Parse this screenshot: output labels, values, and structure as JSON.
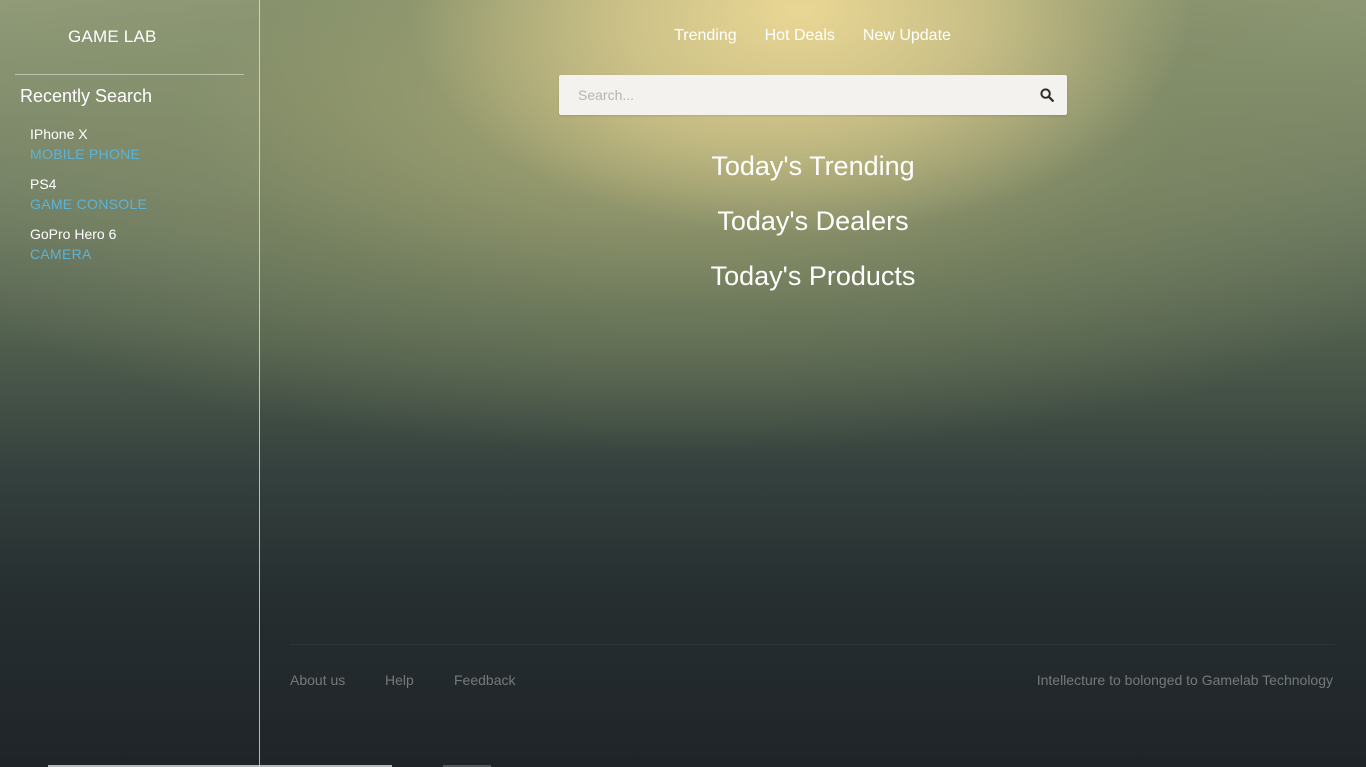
{
  "brand": "GAME LAB",
  "sidebar": {
    "title": "Recently Search",
    "items": [
      {
        "name": "IPhone X",
        "category": "MOBILE PHONE"
      },
      {
        "name": "PS4",
        "category": "GAME CONSOLE"
      },
      {
        "name": "GoPro Hero 6",
        "category": "CAMERA"
      }
    ]
  },
  "nav": {
    "items": [
      "Trending",
      "Hot Deals",
      "New Update"
    ]
  },
  "search": {
    "placeholder": "Search...",
    "value": "",
    "icon": "search-icon"
  },
  "sections": [
    "Today's Trending",
    "Today's Dealers",
    "Today's Products"
  ],
  "footer": {
    "links": [
      "About us",
      "Help",
      "Feedback"
    ],
    "copyright": "Intellecture to bolonged to Gamelab Technology"
  },
  "colors": {
    "category_accent": "#5bb4d6",
    "footer_text": "#76797a",
    "search_bg": "#f3f2ef"
  }
}
